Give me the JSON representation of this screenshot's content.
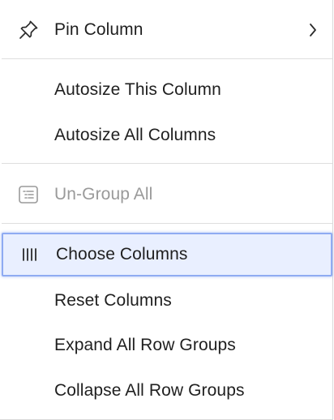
{
  "menu": {
    "items": [
      {
        "id": "pin",
        "label": "Pin Column",
        "icon": "pin-icon",
        "has_submenu": true
      },
      {
        "id": "autosize-this",
        "label": "Autosize This Column"
      },
      {
        "id": "autosize-all",
        "label": "Autosize All Columns"
      },
      {
        "id": "ungroup-all",
        "label": "Un-Group All",
        "icon": "ungroup-icon",
        "disabled": true
      },
      {
        "id": "choose-columns",
        "label": "Choose Columns",
        "icon": "columns-icon",
        "active": true
      },
      {
        "id": "reset-columns",
        "label": "Reset Columns"
      },
      {
        "id": "expand-groups",
        "label": "Expand All Row Groups"
      },
      {
        "id": "collapse-groups",
        "label": "Collapse All Row Groups"
      }
    ]
  },
  "colors": {
    "text": "#1f1f1f",
    "disabled_text": "#9a9a9a",
    "active_background": "#e9efff",
    "active_border": "#8fabf2",
    "separator": "#dedede"
  }
}
